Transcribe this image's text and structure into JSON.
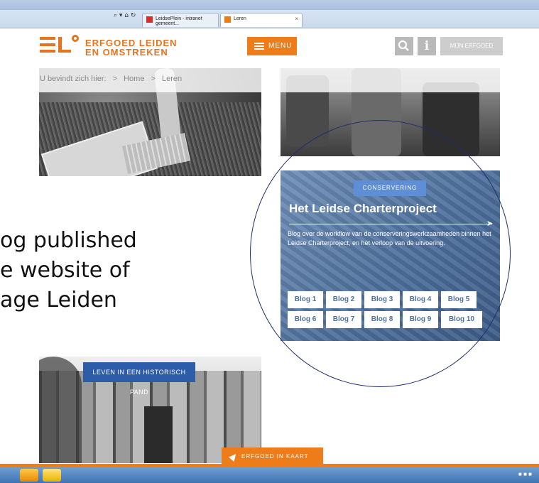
{
  "browser": {
    "address_text": "⌕ ▾ ⌂ ↻",
    "tabs": [
      {
        "label": "LeidsePlein - intranet gemeent...",
        "close": "×"
      },
      {
        "label": "Leren",
        "close": "×"
      }
    ]
  },
  "header": {
    "logo_line1": "ERFGOED LEIDEN",
    "logo_line2": "EN OMSTREKEN",
    "menu_label": "MENU",
    "info_label": "i",
    "mijn_label": "MIJN ERFGOED",
    "brand_color": "#ee7d19"
  },
  "breadcrumb": {
    "prefix": "U bevindt zich hier:",
    "sep": ">",
    "home": "Home",
    "current": "Leren"
  },
  "overlay": {
    "line1": "og published",
    "line2": "e website of",
    "line3": "age Leiden"
  },
  "card": {
    "tag": "CONSERVERING",
    "title": "Het Leidse Charterproject",
    "description": "Blog over de workflow van de conserveringswerkzaamheden binnen het Leidse Charterproject, en het verloop van de uitvoering.",
    "blogs": [
      "Blog 1",
      "Blog 2",
      "Blog 3",
      "Blog 4",
      "Blog 5",
      "Blog 6",
      "Blog 7",
      "Blog 8",
      "Blog 9",
      "Blog 10"
    ]
  },
  "bottom_card": {
    "tag": "LEVEN IN EEN HISTORISCH PAND"
  },
  "kaart": {
    "label": "ERFGOED IN KAART"
  }
}
